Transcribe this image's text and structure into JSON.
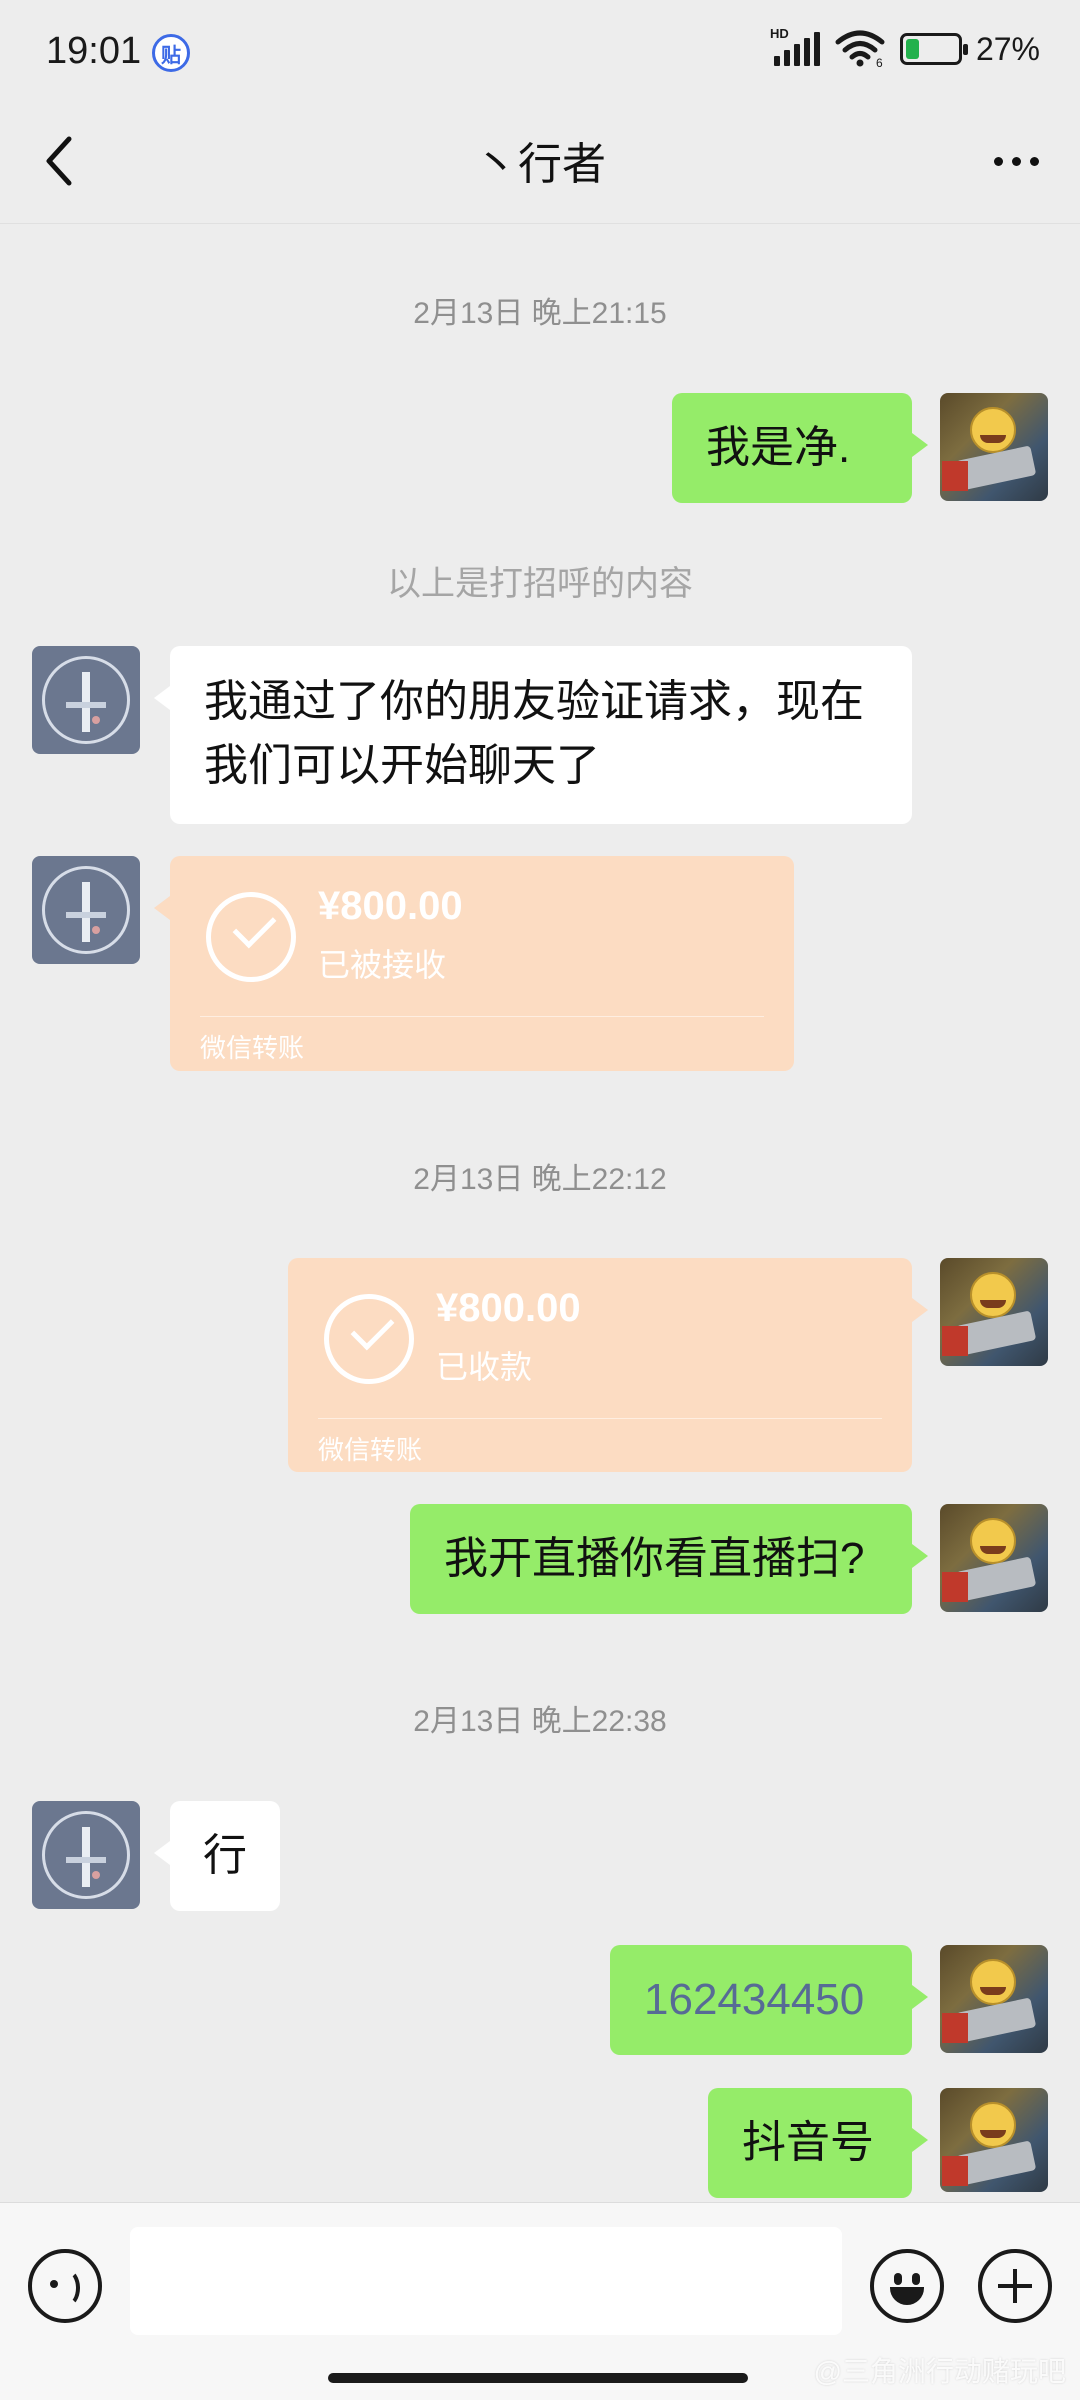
{
  "status_bar": {
    "time": "19:01",
    "app_icon_glyph": "贴",
    "network_label": "HD",
    "wifi_label": "6",
    "battery_percent": 27,
    "battery_text": "27%",
    "icons": [
      "signal-icon",
      "wifi-icon",
      "battery-charging-icon"
    ]
  },
  "nav": {
    "title": "丶行者",
    "back_icon": "chevron-left-icon",
    "more_icon": "more-dots-icon"
  },
  "messages": [
    {
      "type": "timestamp",
      "text": "2月13日 晚上21:15"
    },
    {
      "type": "text",
      "from": "self",
      "text": "我是净."
    },
    {
      "type": "system",
      "text": "以上是打招呼的内容"
    },
    {
      "type": "text",
      "from": "peer",
      "lines": [
        "我通过了你的朋友验证请求，现在",
        "我们可以开始聊天了"
      ]
    },
    {
      "type": "transfer",
      "from": "peer",
      "amount": "¥800.00",
      "status": "已被接收",
      "footer": "微信转账"
    },
    {
      "type": "timestamp",
      "text": "2月13日 晚上22:12"
    },
    {
      "type": "transfer",
      "from": "self",
      "amount": "¥800.00",
      "status": "已收款",
      "footer": "微信转账"
    },
    {
      "type": "text",
      "from": "self",
      "text": "我开直播你看直播扫?"
    },
    {
      "type": "timestamp",
      "text": "2月13日 晚上22:38"
    },
    {
      "type": "text",
      "from": "peer",
      "text": "行"
    },
    {
      "type": "text",
      "from": "self",
      "text": "162434450"
    },
    {
      "type": "text",
      "from": "self",
      "text": "抖音号"
    }
  ],
  "input_bar": {
    "placeholder": "",
    "voice_icon": "voice-icon",
    "emoji_icon": "emoji-icon",
    "plus_icon": "plus-icon"
  },
  "watermark": "@三角洲行动赌玩吧",
  "colors": {
    "background": "#ededed",
    "outgoing_bubble": "#95ec69",
    "incoming_bubble": "#ffffff",
    "transfer_card": "#fcdcc2",
    "link_number": "#576b95",
    "battery": "#22b14c"
  }
}
